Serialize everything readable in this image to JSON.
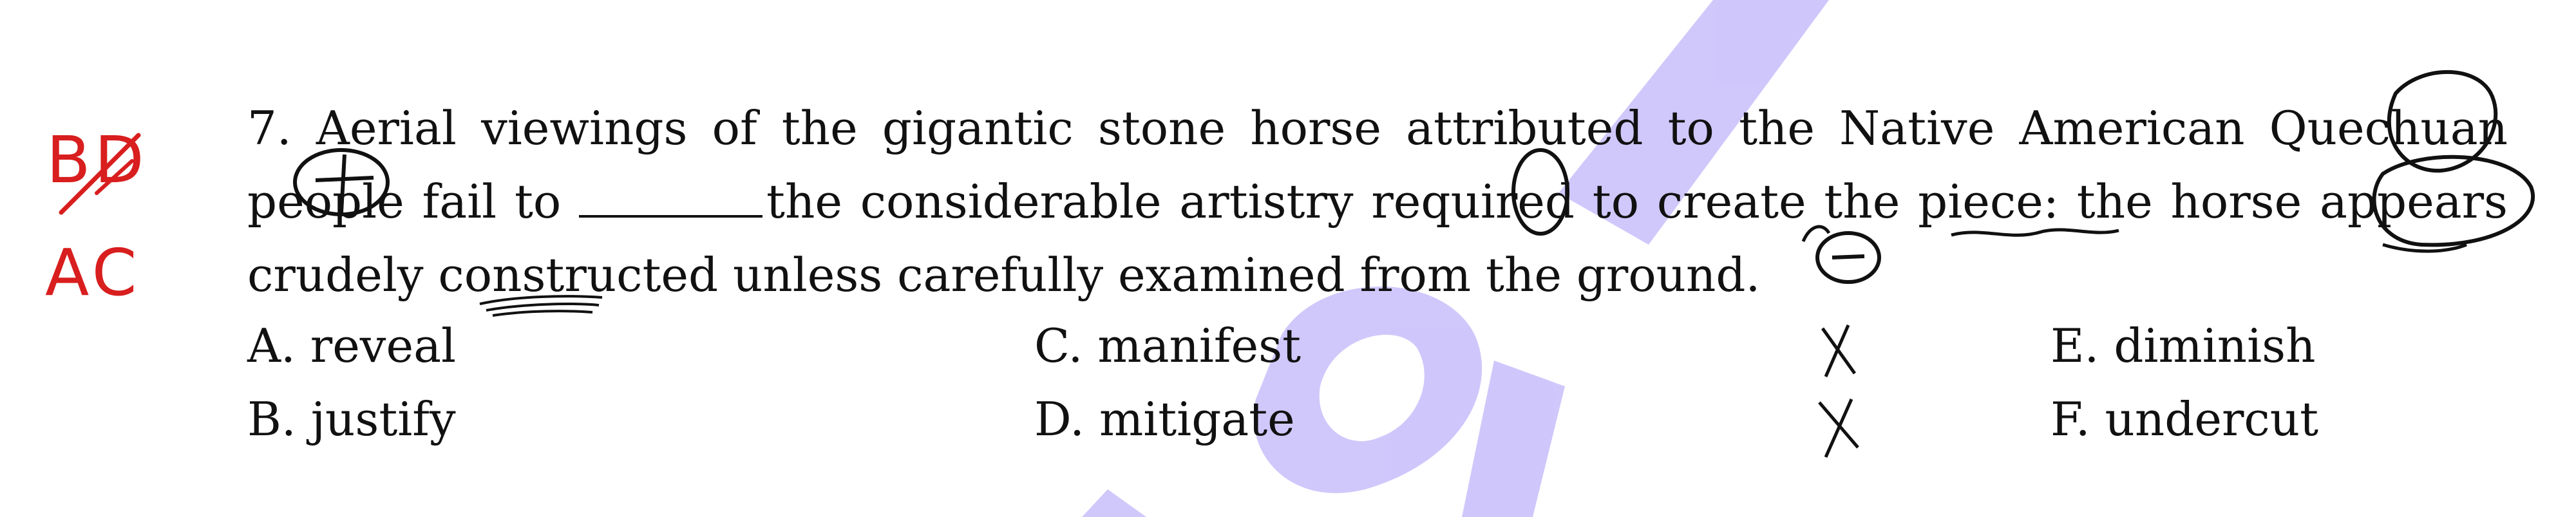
{
  "question": {
    "number": "7.",
    "text_before_blank": "Aerial viewings of the gigantic stone horse attributed to the Native American Quechuan people fail to",
    "text_after_blank": "the considerable artistry required to create the piece: the horse appears crudely constructed unless carefully examined from the ground."
  },
  "options": [
    {
      "letter": "A.",
      "text": "reveal"
    },
    {
      "letter": "B.",
      "text": "justify"
    },
    {
      "letter": "C.",
      "text": "manifest"
    },
    {
      "letter": "D.",
      "text": "mitigate"
    },
    {
      "letter": "E.",
      "text": "diminish"
    },
    {
      "letter": "F.",
      "text": "undercut"
    }
  ],
  "margin_notes": {
    "crossed": "BD",
    "answer": "AC"
  },
  "annotations": {
    "blank_mark": "+",
    "appears_mark": "−"
  },
  "colors": {
    "text": "#111111",
    "annotation_red": "#d81e1e",
    "watermark": "#c9c0fb"
  }
}
